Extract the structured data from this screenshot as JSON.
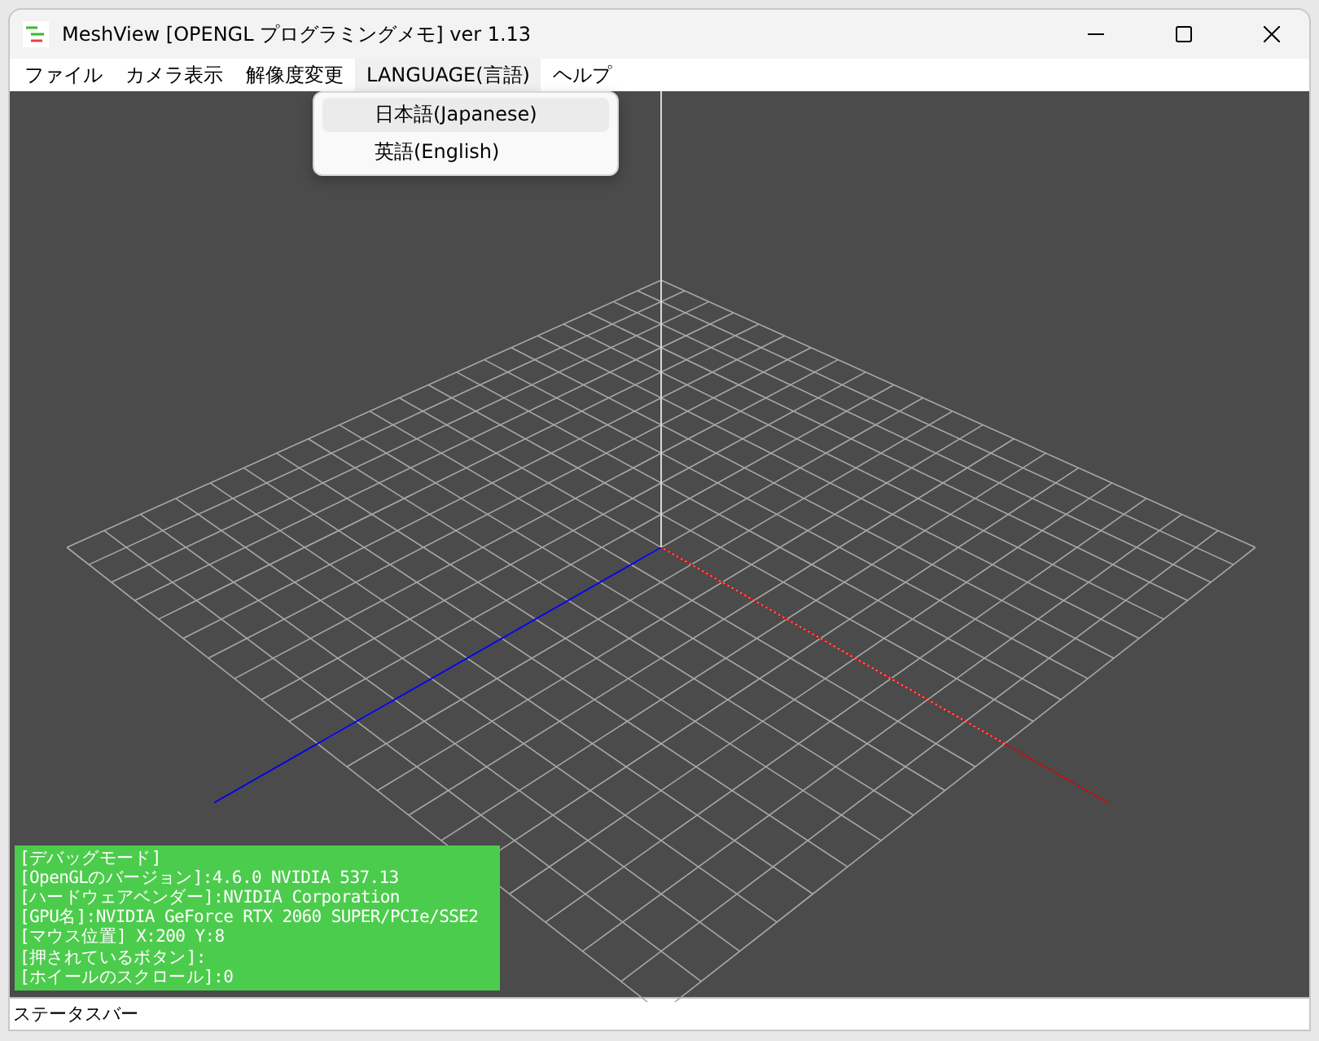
{
  "window": {
    "title": "MeshView [OPENGL プログラミングメモ] ver 1.13"
  },
  "menu_bar": [
    {
      "label": "ファイル",
      "selected": false
    },
    {
      "label": "カメラ表示",
      "selected": false
    },
    {
      "label": "解像度変更",
      "selected": false
    },
    {
      "label": "LANGUAGE(言語)",
      "selected": true
    },
    {
      "label": "ヘルプ",
      "selected": false
    }
  ],
  "dropdown": {
    "items": [
      {
        "label": "日本語(Japanese)",
        "selected": true
      },
      {
        "label": "英語(English)",
        "selected": false
      }
    ]
  },
  "debug_overlay": {
    "lines": [
      "[デバッグモード]",
      "[OpenGLのバージョン]:4.6.0 NVIDIA 537.13",
      "[ハードウェアベンダー]:NVIDIA Corporation",
      "[GPU名]:NVIDIA GeForce RTX 2060 SUPER/PCIe/SSE2",
      "[マウス位置] X:200 Y:8",
      "[押されているボタン]:",
      "[ホイールのスクロール]:0"
    ]
  },
  "status_bar": {
    "text": "ステータスバー"
  }
}
